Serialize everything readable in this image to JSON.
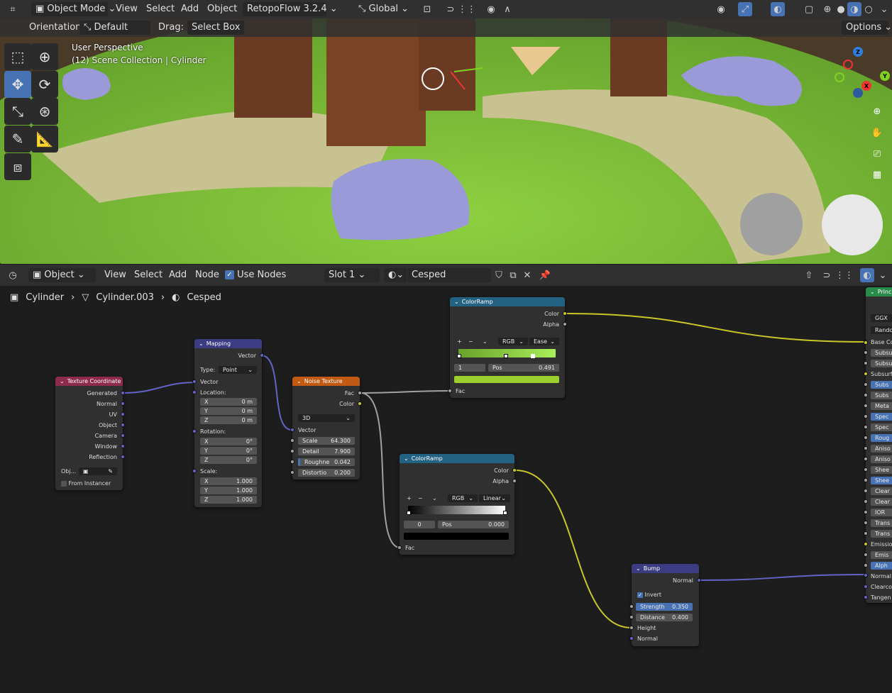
{
  "viewport_header": {
    "mode": "Object Mode",
    "menus": [
      "View",
      "Select",
      "Add",
      "Object"
    ],
    "addon": "RetopoFlow 3.2.4",
    "orientation": "Global"
  },
  "tool_settings": {
    "orientation_label": "Orientation:",
    "orientation_value": "Default",
    "drag_label": "Drag:",
    "drag_value": "Select Box",
    "options": "Options"
  },
  "viewport": {
    "perspective": "User Perspective",
    "collection": "(12) Scene Collection | Cylinder",
    "gizmo_axes": [
      "Z",
      "Y",
      "X"
    ]
  },
  "node_header": {
    "editor_mode": "Object",
    "menus": [
      "View",
      "Select",
      "Add",
      "Node"
    ],
    "use_nodes": "Use Nodes",
    "slot": "Slot 1",
    "material": "Cesped"
  },
  "breadcrumb": {
    "object": "Cylinder",
    "mesh": "Cylinder.003",
    "material": "Cesped"
  },
  "nodes": {
    "texcoord": {
      "title": "Texture Coordinate",
      "outputs": [
        "Generated",
        "Normal",
        "UV",
        "Object",
        "Camera",
        "Window",
        "Reflection"
      ],
      "object_label": "Obj...",
      "from_instancer": "From Instancer"
    },
    "mapping": {
      "title": "Mapping",
      "vector_out": "Vector",
      "type_label": "Type:",
      "type_value": "Point",
      "vector_in": "Vector",
      "location_label": "Location:",
      "location": [
        [
          "X",
          "0 m"
        ],
        [
          "Y",
          "0 m"
        ],
        [
          "Z",
          "0 m"
        ]
      ],
      "rotation_label": "Rotation:",
      "rotation": [
        [
          "X",
          "0°"
        ],
        [
          "Y",
          "0°"
        ],
        [
          "Z",
          "0°"
        ]
      ],
      "scale_label": "Scale:",
      "scale": [
        [
          "X",
          "1.000"
        ],
        [
          "Y",
          "1.000"
        ],
        [
          "Z",
          "1.000"
        ]
      ]
    },
    "noise": {
      "title": "Noise Texture",
      "out_fac": "Fac",
      "out_color": "Color",
      "dim": "3D",
      "vector_in": "Vector",
      "fields": [
        [
          "Scale",
          "64.300"
        ],
        [
          "Detail",
          "7.900"
        ],
        [
          "Roughne",
          "0.042"
        ],
        [
          "Distortio",
          "0.200"
        ]
      ]
    },
    "ramp1": {
      "title": "ColorRamp",
      "out_color": "Color",
      "out_alpha": "Alpha",
      "mode": "RGB",
      "interp": "Ease",
      "index": "1",
      "pos_label": "Pos",
      "pos_value": "0.491",
      "in_fac": "Fac",
      "color_left": "#6aa12a",
      "color_right": "#a8f05a",
      "swatch": "#9bd02e"
    },
    "ramp2": {
      "title": "ColorRamp",
      "out_color": "Color",
      "out_alpha": "Alpha",
      "mode": "RGB",
      "interp": "Linear",
      "index": "0",
      "pos_label": "Pos",
      "pos_value": "0.000",
      "in_fac": "Fac",
      "swatch": "#000000"
    },
    "bump": {
      "title": "Bump",
      "out_normal": "Normal",
      "invert": "Invert",
      "strength_label": "Strength",
      "strength": "0.350",
      "distance_label": "Distance",
      "distance": "0.400",
      "in_height": "Height",
      "in_normal": "Normal"
    },
    "principled": {
      "title": "Princ",
      "dist": "GGX",
      "sss": "Rando",
      "inputs": [
        "Base Co",
        "Subsu",
        "Subsu",
        "Subsurf",
        "Subs",
        "Subs",
        "Meta",
        "Spec",
        "Spec",
        "Roug",
        "Aniso",
        "Aniso",
        "Shee",
        "Shee",
        "Clear",
        "Clear",
        "IOR",
        "Trans",
        "Trans",
        "Emissio",
        "Emis",
        "Alph",
        "Normal",
        "Clearco",
        "Tangen"
      ]
    }
  },
  "colors": {
    "header_bg": "#303030",
    "node_bg": "#303030",
    "header_input": "#8e2a4b",
    "header_vector": "#3c3c83",
    "header_texture": "#c25a14",
    "header_converter": "#246283",
    "header_shader": "#2a8a4a",
    "link_color": "#c7c729",
    "link_gray": "#a1a1a1",
    "link_vector": "#6363c7"
  }
}
